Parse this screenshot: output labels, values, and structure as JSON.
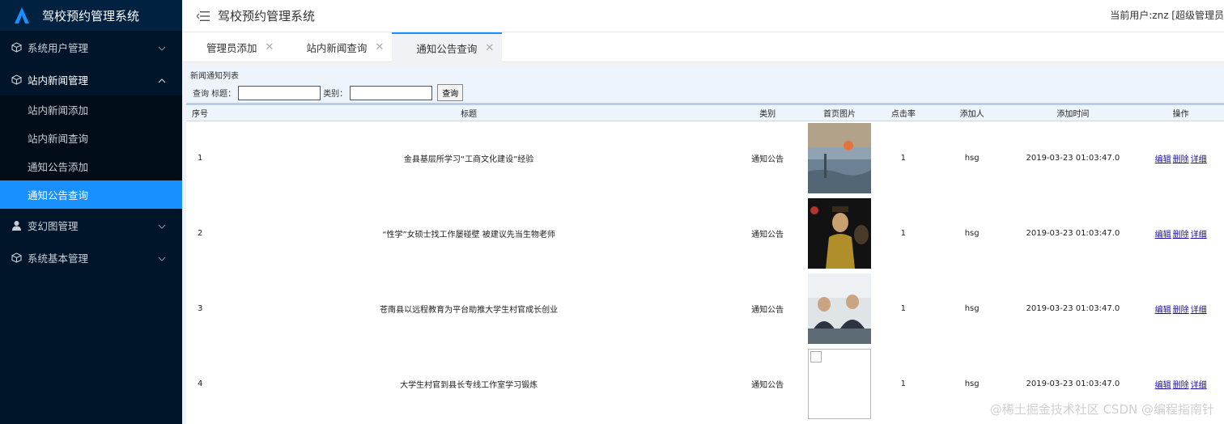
{
  "app": {
    "title": "驾校预约管理系统"
  },
  "sidebar": {
    "menus": [
      {
        "label": "系统用户管理",
        "icon": "cube-icon",
        "open": false,
        "items": []
      },
      {
        "label": "站内新闻管理",
        "icon": "cube-icon",
        "open": true,
        "items": [
          {
            "label": "站内新闻添加"
          },
          {
            "label": "站内新闻查询"
          },
          {
            "label": "通知公告添加"
          },
          {
            "label": "通知公告查询",
            "active": true
          }
        ]
      },
      {
        "label": "变幻图管理",
        "icon": "user-icon",
        "open": false,
        "items": []
      },
      {
        "label": "系统基本管理",
        "icon": "cube-icon",
        "open": false,
        "items": []
      }
    ]
  },
  "header": {
    "title": "驾校预约管理系统",
    "user": "当前用户:znz [超级管理员"
  },
  "tabs": [
    {
      "label": "管理员添加",
      "active": false
    },
    {
      "label": "站内新闻查询",
      "active": false
    },
    {
      "label": "通知公告查询",
      "active": true
    }
  ],
  "content": {
    "list_title": "新闻通知列表",
    "query": {
      "prefix": "查询",
      "title_label": "标题：",
      "title_value": "",
      "category_label": "类别：",
      "category_value": "",
      "button": "查询"
    },
    "columns": [
      "序号",
      "标题",
      "类别",
      "首页图片",
      "点击率",
      "添加人",
      "添加时间",
      "操作"
    ],
    "rows": [
      {
        "no": "1",
        "title": "金县基层所学习“工商文化建设”经验",
        "category": "通知公告",
        "image": "painting",
        "clicks": "1",
        "author": "hsg",
        "time": "2019-03-23 01:03:47.0"
      },
      {
        "no": "2",
        "title": "“性学”女硕士找工作屡碰壁 被建议先当生物老师",
        "category": "通知公告",
        "image": "dark-portrait",
        "clicks": "1",
        "author": "hsg",
        "time": "2019-03-23 01:03:47.0"
      },
      {
        "no": "3",
        "title": "苍南县以远程教育为平台助推大学生村官成长创业",
        "category": "通知公告",
        "image": "meeting-photo",
        "clicks": "1",
        "author": "hsg",
        "time": "2019-03-23 01:03:47.0"
      },
      {
        "no": "4",
        "title": "大学生村官到县长专线工作室学习锻炼",
        "category": "通知公告",
        "image": "broken",
        "clicks": "1",
        "author": "hsg",
        "time": "2019-03-23 01:03:47.0"
      }
    ],
    "ops": [
      "编辑",
      "删除",
      "详细"
    ]
  },
  "watermark": "@稀土掘金技术社区 CSDN @编程指南针"
}
